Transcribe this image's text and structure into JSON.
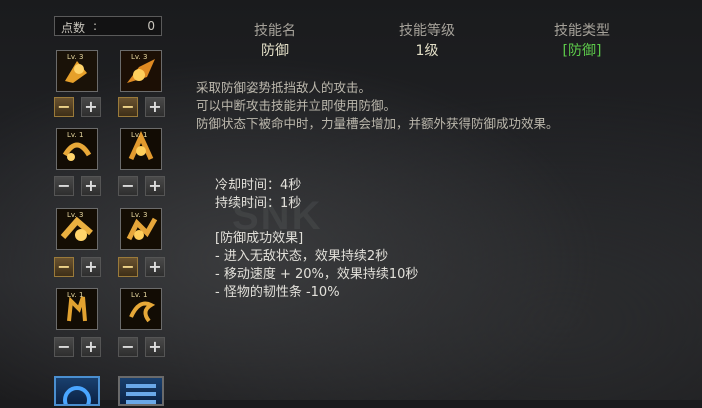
{
  "points": {
    "label": "点数",
    "sep": ":",
    "value": "0"
  },
  "slots": [
    {
      "level": "Lv. 3"
    },
    {
      "level": "Lv. 3"
    },
    {
      "level": "Lv. 1"
    },
    {
      "level": "Lv. 1"
    },
    {
      "level": "Lv. 3"
    },
    {
      "level": "Lv. 3"
    },
    {
      "level": "Lv. 1"
    },
    {
      "level": "Lv. 1"
    }
  ],
  "buttons": {
    "minus": "−",
    "plus": "+"
  },
  "header": {
    "name_label": "技能名",
    "level_label": "技能等级",
    "type_label": "技能类型",
    "name": "防御",
    "level": "1级",
    "type": "[防御]"
  },
  "description": [
    "采取防御姿势抵挡敌人的攻击。",
    "可以中断攻击技能并立即使用防御。",
    "防御状态下被命中时，力量槽会增加，并额外获得防御成功效果。"
  ],
  "stats": {
    "cooldown": "冷却时间：4秒",
    "duration": "持续时间：1秒"
  },
  "success": {
    "title": "[防御成功效果]",
    "items": [
      "- 进入无敌状态，效果持续2秒",
      "- 移动速度 + 20%，效果持续10秒",
      "- 怪物的韧性条 -10%"
    ]
  },
  "watermark": "SNK",
  "colors": {
    "accent": "#e6b040",
    "type_green": "#5cc94a"
  }
}
